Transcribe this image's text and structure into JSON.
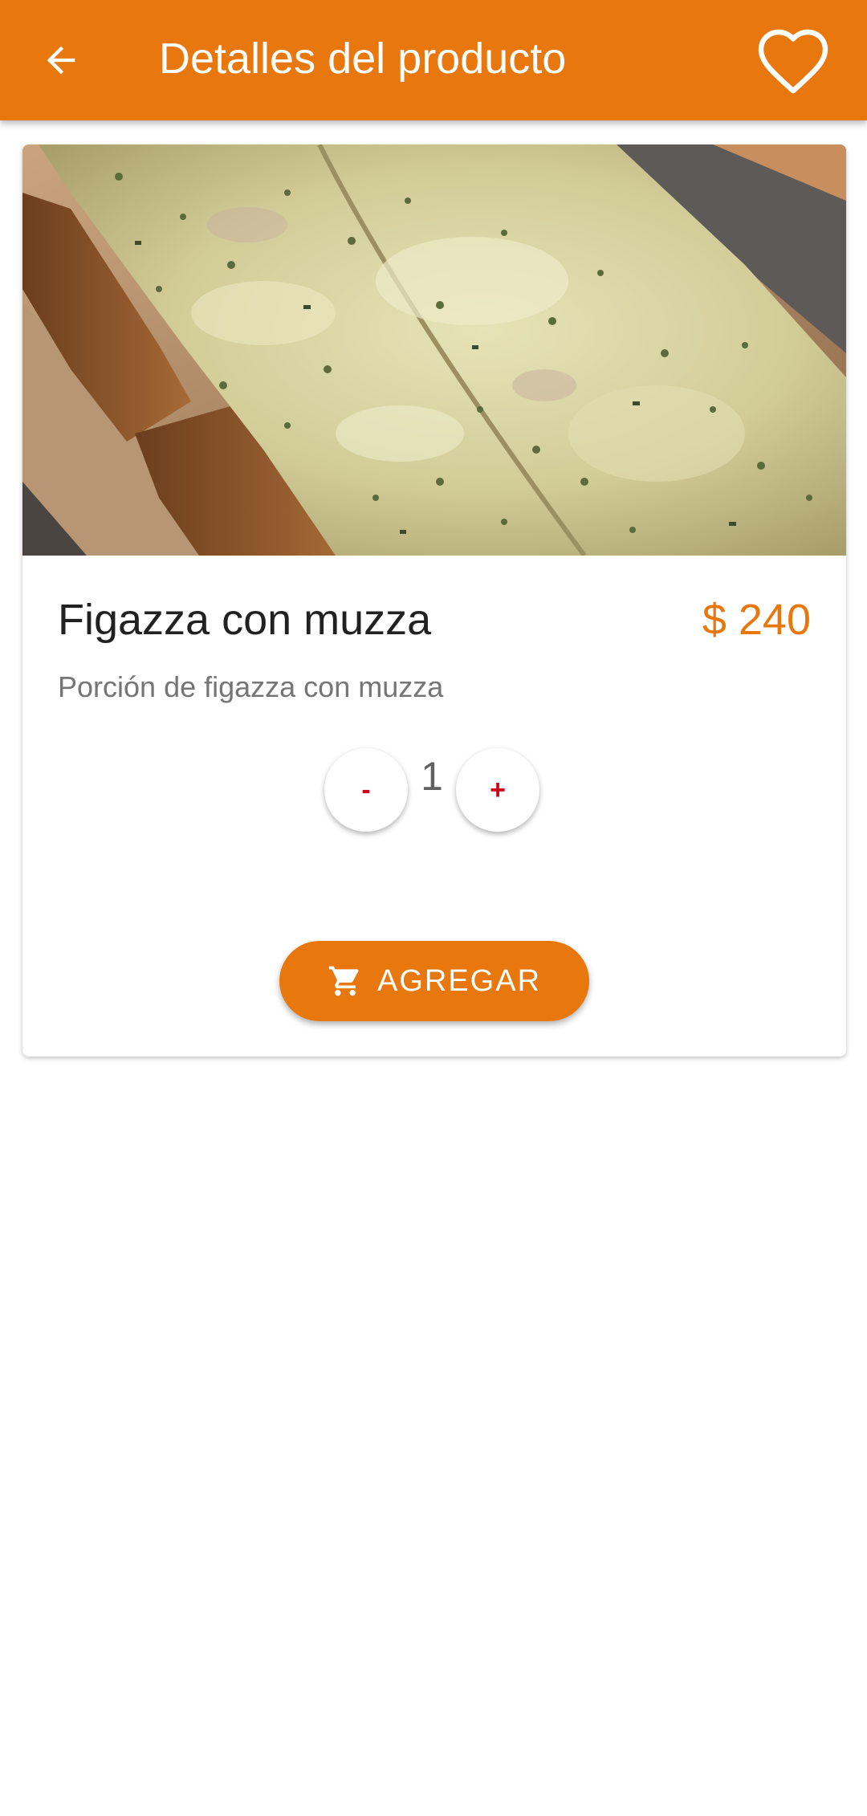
{
  "app_bar": {
    "title": "Detalles del producto",
    "back_icon": "arrow-back-icon",
    "favorite_icon": "heart-outline-icon",
    "color": "#E8780D"
  },
  "product": {
    "image": "pizza-figazza-photo",
    "name": "Figazza con muzza",
    "price": "$ 240",
    "description": "Porción de figazza con muzza"
  },
  "quantity": {
    "minus_label": "-",
    "value": "1",
    "plus_label": "+"
  },
  "actions": {
    "add_label": "AGREGAR",
    "add_icon": "cart-icon"
  }
}
